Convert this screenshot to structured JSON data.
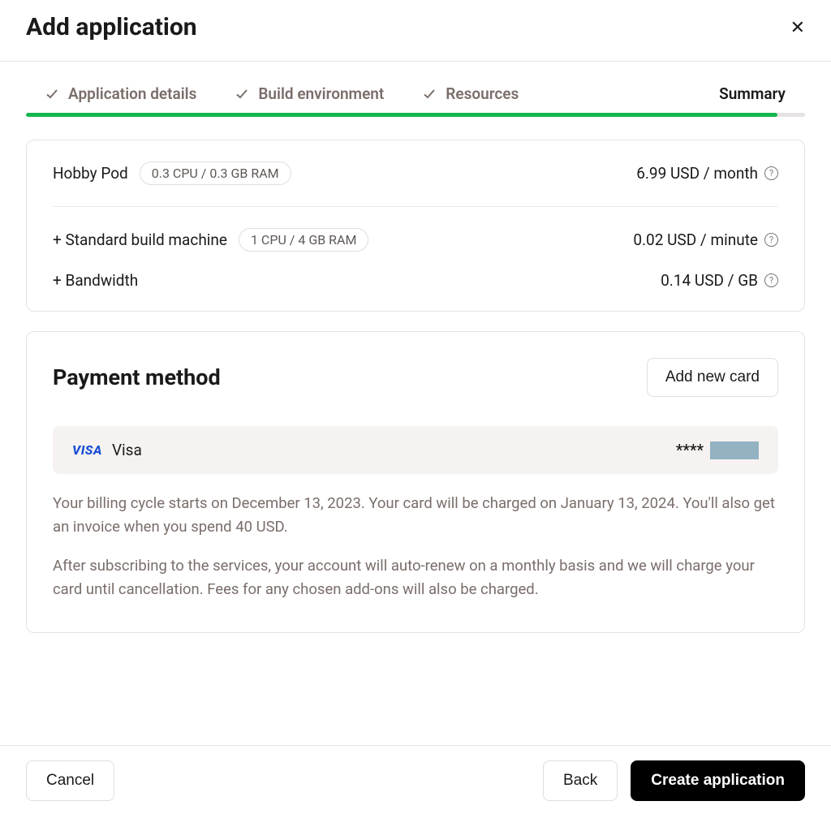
{
  "header": {
    "title": "Add application"
  },
  "stepper": {
    "steps": [
      {
        "label": "Application details",
        "done": true
      },
      {
        "label": "Build environment",
        "done": true
      },
      {
        "label": "Resources",
        "done": true
      },
      {
        "label": "Summary",
        "active": true
      }
    ]
  },
  "summary": {
    "items": [
      {
        "name": "Hobby Pod",
        "spec": "0.3 CPU / 0.3 GB RAM",
        "price": "6.99 USD / month",
        "info": true,
        "divider_after": true
      },
      {
        "name": "+ Standard build machine",
        "spec": "1 CPU / 4 GB RAM",
        "price": "0.02 USD / minute",
        "info": true
      },
      {
        "name": "+ Bandwidth",
        "spec": null,
        "price": "0.14 USD / GB",
        "info": true
      }
    ]
  },
  "payment": {
    "heading": "Payment method",
    "add_card_label": "Add new card",
    "card": {
      "brand_logo": "VISA",
      "brand": "Visa",
      "mask": "****"
    },
    "note1": "Your billing cycle starts on December 13, 2023. Your card will be charged on January 13, 2024. You'll also get an invoice when you spend 40 USD.",
    "note2": "After subscribing to the services, your account will auto-renew on a monthly basis and we will charge your card until cancellation. Fees for any chosen add-ons will also be charged."
  },
  "footer": {
    "cancel": "Cancel",
    "back": "Back",
    "create": "Create application"
  }
}
